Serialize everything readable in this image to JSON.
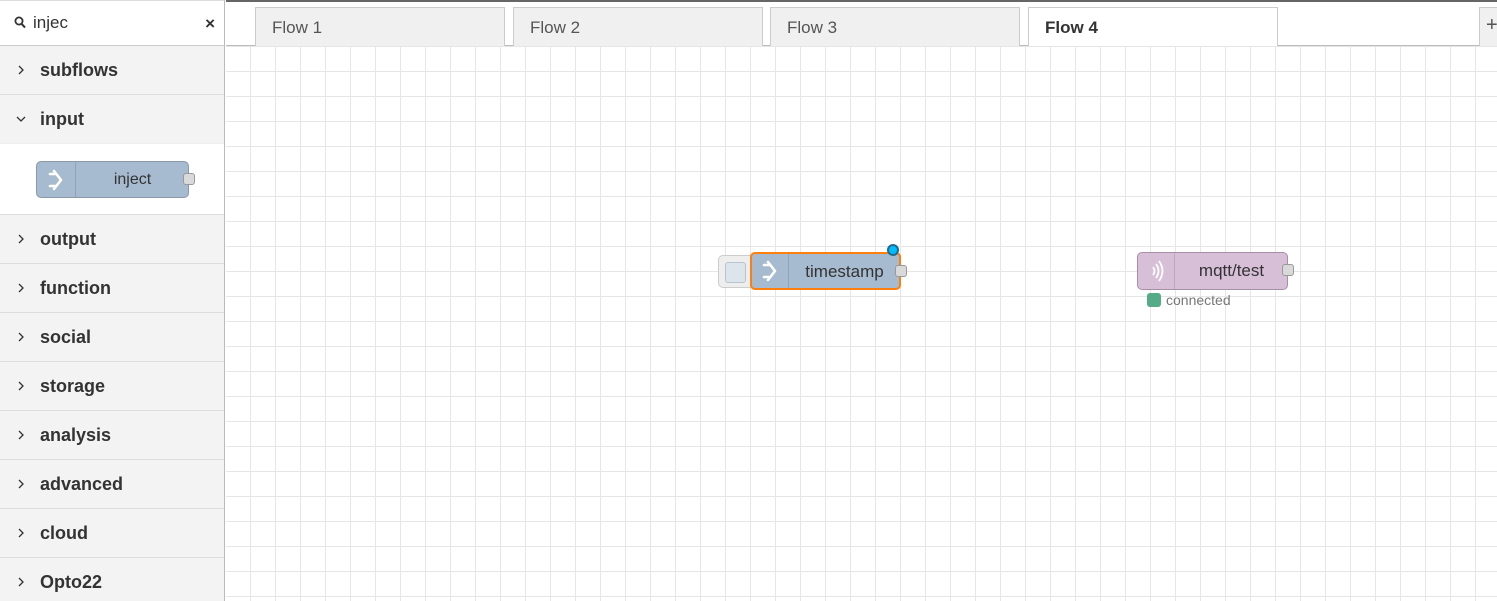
{
  "palette": {
    "search": {
      "value": "injec",
      "clear_glyph": "×"
    },
    "categories": [
      {
        "label": "subflows",
        "expanded": false
      },
      {
        "label": "input",
        "expanded": true
      },
      {
        "label": "output",
        "expanded": false
      },
      {
        "label": "function",
        "expanded": false
      },
      {
        "label": "social",
        "expanded": false
      },
      {
        "label": "storage",
        "expanded": false
      },
      {
        "label": "analysis",
        "expanded": false
      },
      {
        "label": "advanced",
        "expanded": false
      },
      {
        "label": "cloud",
        "expanded": false
      },
      {
        "label": "Opto22",
        "expanded": false
      }
    ],
    "input_nodes": [
      {
        "label": "inject",
        "color": "#a6bbcf",
        "icon": "inject-arrow-icon"
      }
    ]
  },
  "tabs": [
    {
      "label": "Flow 1",
      "active": false
    },
    {
      "label": "Flow 2",
      "active": false
    },
    {
      "label": "Flow 3",
      "active": false
    },
    {
      "label": "Flow 4",
      "active": true
    }
  ],
  "add_tab_glyph": "+",
  "workspace": {
    "nodes": [
      {
        "label": "timestamp",
        "type": "inject",
        "color": "#a6bbcf",
        "selected": true,
        "changed": true,
        "icon": "inject-arrow-icon"
      },
      {
        "label": "mqtt/test",
        "type": "mqtt in",
        "color": "#d8bfd8",
        "icon": "mqtt-wave-icon",
        "status": {
          "text": "connected",
          "color": "#55aa88"
        }
      }
    ]
  },
  "colors": {
    "selection": "#ff7f0e",
    "changed": "#00bcff"
  }
}
